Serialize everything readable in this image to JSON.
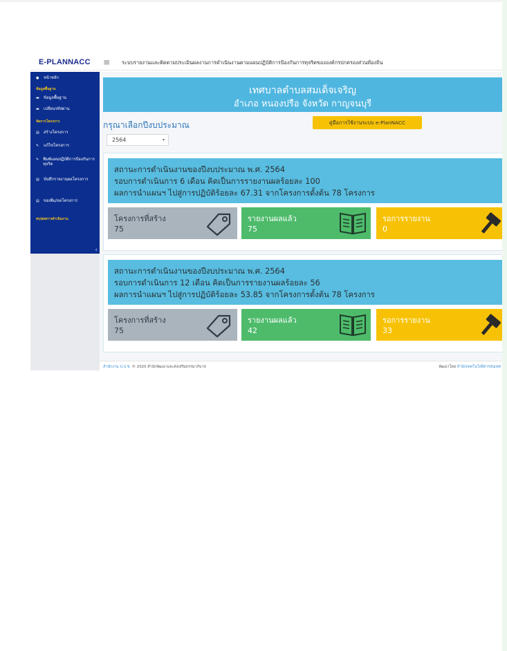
{
  "brand": "E-PLANNACC",
  "header_title": "ระบบรายงานและติดตามประเมินผลงานการดำเนินงานตามแผนปฏิบัติการป้องกันการทุจริตขององค์กรปกครองส่วนท้องถิ่น",
  "sidebar": {
    "home": "หน้าหลัก",
    "head_basic": "ข้อมูลพื้นฐาน",
    "basic_data": "ข้อมูลพื้นฐาน",
    "change_password": "เปลี่ยนรหัสผ่าน",
    "head_manage": "จัดการโครงการ",
    "create_project": "สร้างโครงการ",
    "edit_project": "แก้ไขโครงการ",
    "print_plan": "พิมพ์แผนปฏิบัติการป้องกันการทุจริต",
    "record_report": "บันทึกรายงานผลโครงการ",
    "add_remove": "ขอเพิ่ม/ลดโครงการ",
    "head_summary": "สรุปผลการดำเนินงาน",
    "collapse_glyph": "‹"
  },
  "banner": {
    "line1": "เทศบาลตำบลสมเด็จเจริญ",
    "line2": "อำเภอ หนองปรือ จังหวัด กาญจนบุรี"
  },
  "select_label": "กรุณาเลือกปีงบประมาณ",
  "manual_button": "คู่มือการใช้งานระบบ e-PlanNACC",
  "year_select": {
    "value": "2564",
    "caret": "▾"
  },
  "panels": [
    {
      "line1": "สถานะการดำเนินงานของปีงบประมาณ พ.ศ. 2564",
      "line2": "รอบการดำเนินการ 6 เดือน คิดเป็นการรายงานผลร้อยละ 100",
      "line3": "ผลการนำแผนฯ ไปสู่การปฏิบัติร้อยละ 67.31 จากโครงการตั้งต้น 78 โครงการ",
      "created_label": "โครงการที่สร้าง",
      "created_value": "75",
      "reported_label": "รายงานผลแล้ว",
      "reported_value": "75",
      "pending_label": "รอการรายงาน",
      "pending_value": "0"
    },
    {
      "line1": "สถานะการดำเนินงานของปีงบประมาณ พ.ศ. 2564",
      "line2": "รอบการดำเนินการ 12 เดือน คิดเป็นการรายงานผลร้อยละ 56",
      "line3": "ผลการนำแผนฯ ไปสู่การปฏิบัติร้อยละ 53.85 จากโครงการตั้งต้น 78 โครงการ",
      "created_label": "โครงการที่สร้าง",
      "created_value": "75",
      "reported_label": "รายงานผลแล้ว",
      "reported_value": "42",
      "pending_label": "รอการรายงาน",
      "pending_value": "33"
    }
  ],
  "footer": {
    "left_link": "สำนักงาน ป.ป.ช.",
    "left_text": "© 2020 สำนักพัฒนาและส่งเสริมธรรมาภิบาล",
    "right_text": "พัฒนาโดย",
    "right_link": "สำนักเทคโนโลยีสารสนเทศ"
  },
  "colors": {
    "sidebar": "#0b2e8f",
    "banner": "#4fb6e0",
    "status": "#58bde0",
    "card_gray": "#a9b4bd",
    "card_green": "#4ebb6b",
    "card_yellow": "#f7c205"
  }
}
